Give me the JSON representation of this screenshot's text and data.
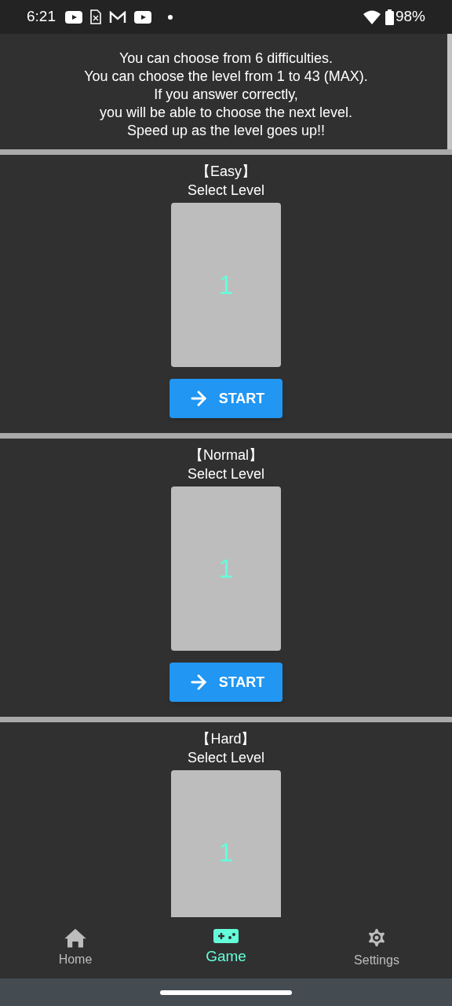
{
  "status_bar": {
    "time": "6:21",
    "battery": "98%"
  },
  "intro": [
    "You can choose from 6 difficulties.",
    "You can choose the level from 1 to 43 (MAX).",
    "If you answer correctly,",
    "you will be able to choose the next level.",
    "Speed up as the level goes up!!"
  ],
  "sections": [
    {
      "title": "【Easy】",
      "subtitle": "Select Level",
      "level_value": "1",
      "button": "START"
    },
    {
      "title": "【Normal】",
      "subtitle": "Select Level",
      "level_value": "1",
      "button": "START"
    },
    {
      "title": "【Hard】",
      "subtitle": "Select Level",
      "level_value": "1"
    }
  ],
  "bottom_nav": [
    {
      "kind": "home",
      "label": "Home",
      "selected": false
    },
    {
      "kind": "game",
      "label": "Game",
      "selected": true
    },
    {
      "kind": "settings",
      "label": "Settings",
      "selected": false
    }
  ]
}
